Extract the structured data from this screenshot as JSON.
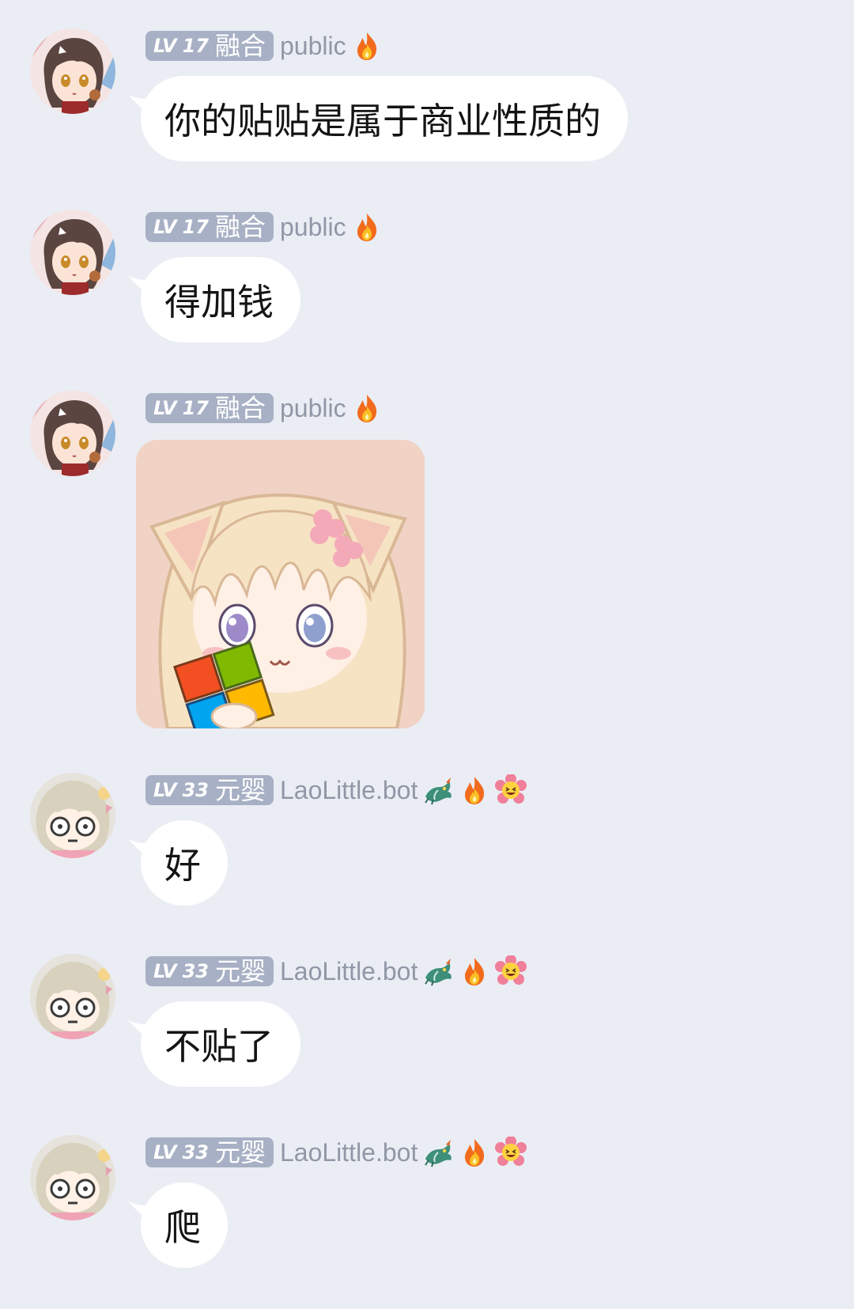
{
  "messages": [
    {
      "avatar": "brown-haired-anime-girl-avatar",
      "level_prefix": "LV",
      "level": "17",
      "title": "融合",
      "username": "public",
      "emojis": [
        "fire"
      ],
      "type": "text",
      "text": "你的贴贴是属于商业性质的"
    },
    {
      "avatar": "brown-haired-anime-girl-avatar",
      "level_prefix": "LV",
      "level": "17",
      "title": "融合",
      "username": "public",
      "emojis": [
        "fire"
      ],
      "type": "text",
      "text": "得加钱"
    },
    {
      "avatar": "brown-haired-anime-girl-avatar",
      "level_prefix": "LV",
      "level": "17",
      "title": "融合",
      "username": "public",
      "emojis": [
        "fire"
      ],
      "type": "sticker",
      "sticker": "cat-ear-girl-eating-windows-logo-sticker"
    },
    {
      "avatar": "blonde-chibi-girl-avatar",
      "level_prefix": "LV",
      "level": "33",
      "title": "元婴",
      "username": "LaoLittle.bot",
      "emojis": [
        "dragon",
        "fire",
        "grinning-flower"
      ],
      "type": "text",
      "text": "好"
    },
    {
      "avatar": "blonde-chibi-girl-avatar",
      "level_prefix": "LV",
      "level": "33",
      "title": "元婴",
      "username": "LaoLittle.bot",
      "emojis": [
        "dragon",
        "fire",
        "grinning-flower"
      ],
      "type": "text",
      "text": "不贴了"
    },
    {
      "avatar": "blonde-chibi-girl-avatar",
      "level_prefix": "LV",
      "level": "33",
      "title": "元婴",
      "username": "LaoLittle.bot",
      "emojis": [
        "dragon",
        "fire",
        "grinning-flower"
      ],
      "type": "text",
      "text": "爬"
    }
  ],
  "colors": {
    "background": "#eaedf4",
    "bubble": "#ffffff",
    "badge": "#a7b0c4",
    "username": "#9097a6"
  }
}
